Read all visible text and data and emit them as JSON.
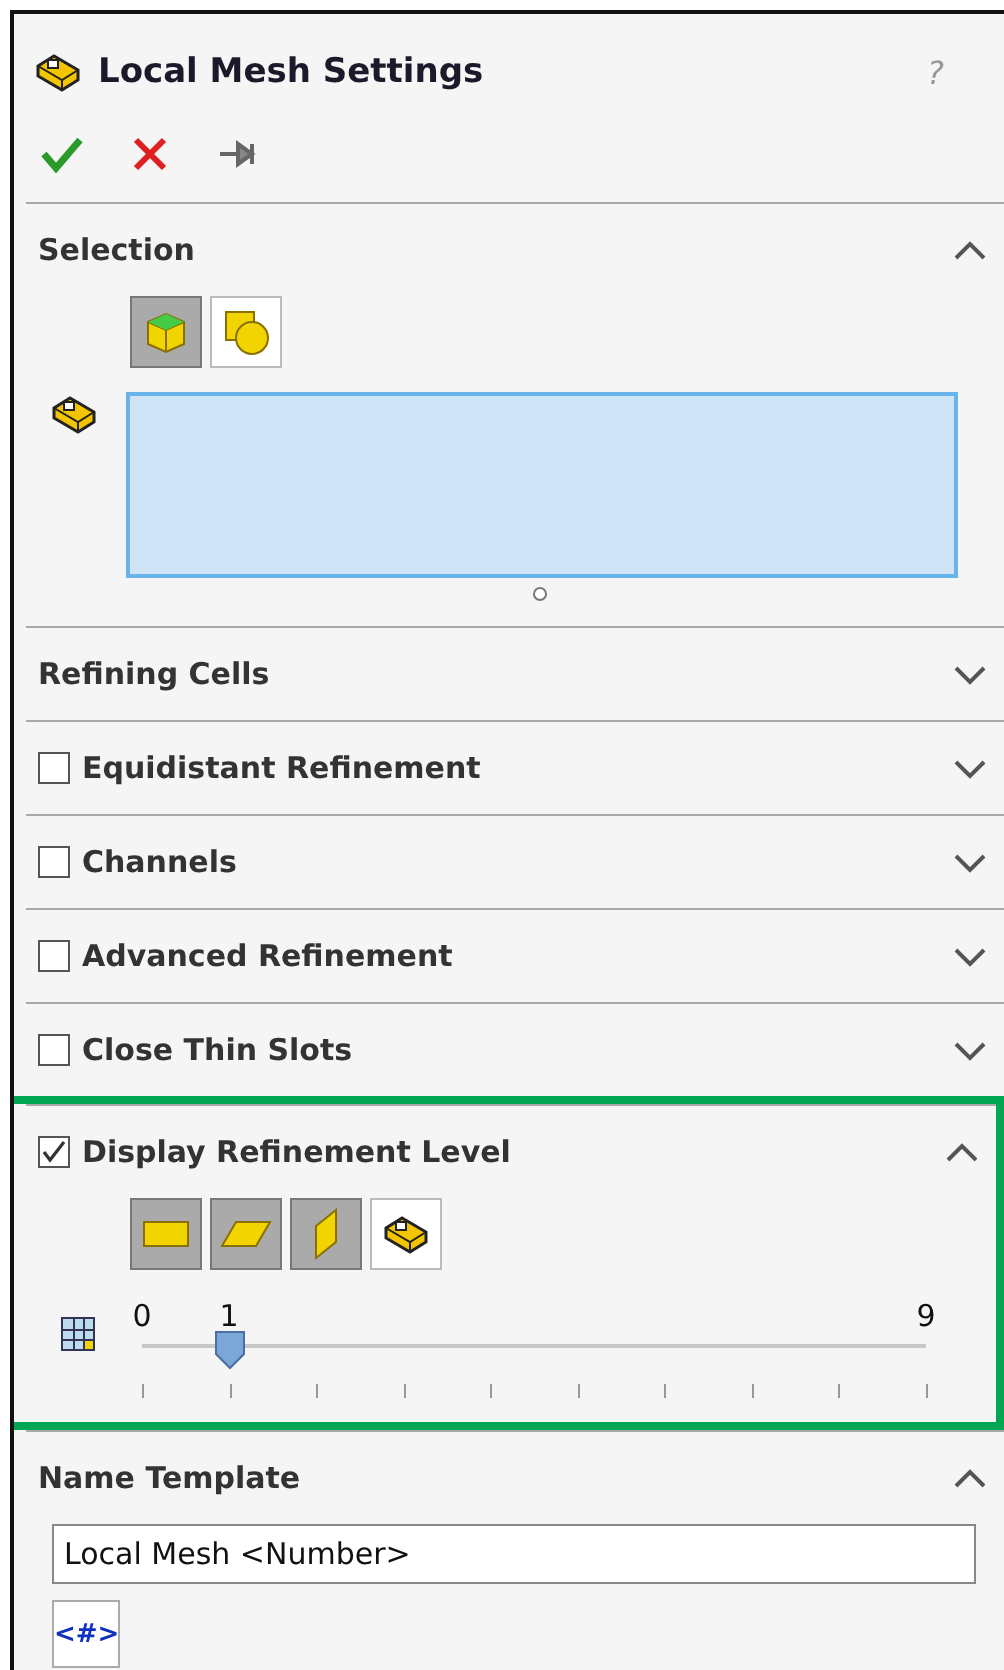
{
  "window": {
    "title": "Local Mesh Settings",
    "help": "?"
  },
  "sections": [
    {
      "kind": "selection",
      "title": "Selection",
      "expanded": true,
      "filters": [
        {
          "selected": true
        },
        {
          "selected": false
        }
      ]
    },
    {
      "kind": "plain",
      "title": "Refining Cells",
      "expanded": false
    },
    {
      "kind": "checkbox",
      "title": "Equidistant Refinement",
      "checked": false,
      "expanded": false
    },
    {
      "kind": "checkbox",
      "title": "Channels",
      "checked": false,
      "expanded": false
    },
    {
      "kind": "checkbox",
      "title": "Advanced Refinement",
      "checked": false,
      "expanded": false
    },
    {
      "kind": "checkbox",
      "title": "Close Thin Slots",
      "checked": false,
      "expanded": false
    },
    {
      "kind": "display",
      "title": "Display Refinement Level",
      "checked": true,
      "expanded": true,
      "highlighted": true,
      "views": [
        {
          "selected": true
        },
        {
          "selected": true
        },
        {
          "selected": true
        },
        {
          "selected": false
        }
      ],
      "slider": {
        "min_label": "0",
        "max_label": "9",
        "value_label": "1",
        "level": 0.111
      }
    },
    {
      "kind": "template",
      "title": "Name Template",
      "expanded": true,
      "value": "Local Mesh <Number>",
      "insert_button": "<#>"
    }
  ]
}
